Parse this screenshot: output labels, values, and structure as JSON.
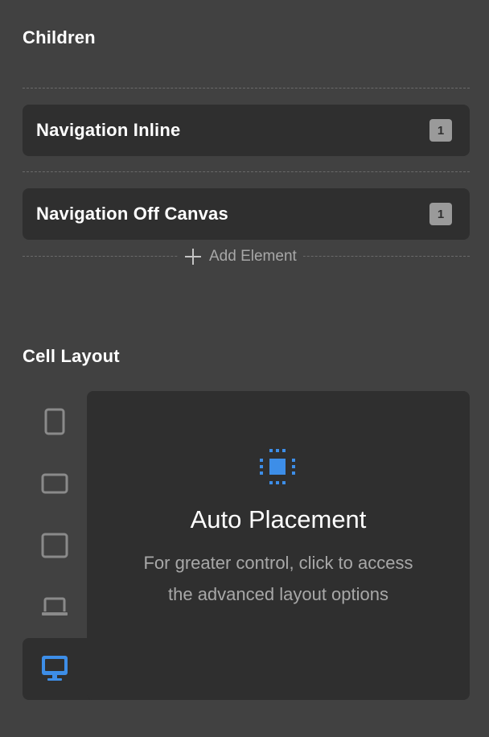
{
  "children_section": {
    "title": "Children",
    "items": [
      {
        "label": "Navigation Inline",
        "count": "1"
      },
      {
        "label": "Navigation Off Canvas",
        "count": "1"
      }
    ],
    "add_label": "Add Element"
  },
  "cell_layout": {
    "title": "Cell Layout",
    "devices": [
      {
        "icon": "mobile-icon",
        "active": false
      },
      {
        "icon": "tablet-landscape-icon",
        "active": false
      },
      {
        "icon": "tablet-icon",
        "active": false
      },
      {
        "icon": "laptop-icon",
        "active": false
      },
      {
        "icon": "desktop-icon",
        "active": true
      }
    ],
    "panel": {
      "icon": "auto-placement-icon",
      "title": "Auto Placement",
      "description": "For greater control, click to access the advanced layout options"
    }
  },
  "colors": {
    "background": "#414141",
    "card": "#2f2f2f",
    "accent": "#3d8ee8",
    "muted_icon": "#8a8a8a",
    "muted_text": "#a8a8a8"
  }
}
